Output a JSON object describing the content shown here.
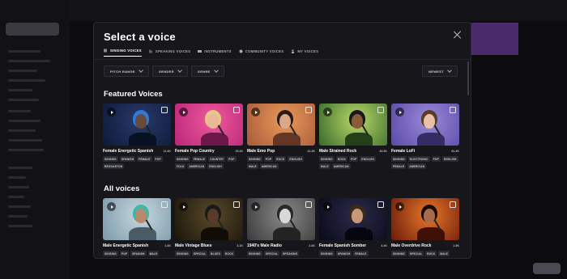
{
  "modal": {
    "title": "Select a voice",
    "tabs": [
      {
        "label": "SINGING VOICES",
        "icon": "bars-icon",
        "active": true
      },
      {
        "label": "SPEAKING VOICES",
        "icon": "speech-icon",
        "active": false
      },
      {
        "label": "INSTRUMENTS",
        "icon": "instrument-icon",
        "active": false
      },
      {
        "label": "COMMUNITY VOICES",
        "icon": "globe-icon",
        "active": false
      },
      {
        "label": "MY VOICES",
        "icon": "person-icon",
        "active": false
      }
    ],
    "filters": [
      {
        "label": "PITCH RANGE"
      },
      {
        "label": "GENDER"
      },
      {
        "label": "GENRE"
      }
    ],
    "sort": {
      "label": "NEWEST"
    }
  },
  "featured": {
    "title": "Featured Voices",
    "cards": [
      {
        "name": "Female Energetic Spanish",
        "count": "11.4K",
        "tags": [
          "SINGING",
          "SPANISH",
          "FEMALE",
          "POP",
          "REGGAETON"
        ],
        "bg": [
          "#2a3a6a",
          "#0d1a3a"
        ],
        "skin": "#6a4a3a",
        "hair": "#2c7bd8"
      },
      {
        "name": "Female Pop Country",
        "count": "19.2K",
        "tags": [
          "SINGING",
          "FEMALE",
          "COUNTRY",
          "POP",
          "FOLK",
          "AMERICAN",
          "ENGLISH"
        ],
        "bg": [
          "#f05a9a",
          "#b8267a"
        ],
        "skin": "#e8b898",
        "hair": "#e8c888"
      },
      {
        "name": "Male Emo Pop",
        "count": "41.2K",
        "tags": [
          "SINGING",
          "POP",
          "ROCK",
          "ENGLISH",
          "MALE",
          "AMERICAN"
        ],
        "bg": [
          "#e89a5a",
          "#a85a3a"
        ],
        "skin": "#d8a888",
        "hair": "#2a1a1a"
      },
      {
        "name": "Male Strained Rock",
        "count": "43.3K",
        "tags": [
          "SINGING",
          "ROCK",
          "POP",
          "ENGLISH",
          "MALE",
          "AMERICAN"
        ],
        "bg": [
          "#b8d86a",
          "#3a6a2a"
        ],
        "skin": "#8a5a3a",
        "hair": "#1a1a1a"
      },
      {
        "name": "Female LoFi",
        "count": "81.4K",
        "tags": [
          "SINGING",
          "ELECTRONIC",
          "POP",
          "ENGLISH",
          "FEMALE",
          "AMERICAN"
        ],
        "bg": [
          "#9a8ad8",
          "#5a4aa8"
        ],
        "skin": "#e8c0a8",
        "hair": "#5a3a2a"
      }
    ]
  },
  "all": {
    "title": "All voices",
    "cards": [
      {
        "name": "Male Energetic Spanish",
        "count": "1.6K",
        "tags": [
          "SINGING",
          "POP",
          "SPANISH",
          "MALE"
        ],
        "bg": [
          "#c8d8e0",
          "#7a98a8"
        ],
        "skin": "#b88a6a",
        "hair": "#3ab8a8"
      },
      {
        "name": "Male Vintage Blues",
        "count": "3.1K",
        "tags": [
          "SINGING",
          "SPECIAL",
          "BLUES",
          "ROCK"
        ],
        "bg": [
          "#5a4a2a",
          "#1a140a"
        ],
        "skin": "#5a3a2a",
        "hair": "#1a1a1a"
      },
      {
        "name": "1940's Male Radio",
        "count": "2.6K",
        "tags": [
          "SINGING",
          "SPECIAL",
          "SPEAKING"
        ],
        "bg": [
          "#8a8a8a",
          "#3a3a3a"
        ],
        "skin": "#d8d8d8",
        "hair": "#2a2a2a"
      },
      {
        "name": "Female Spanish Somber",
        "count": "4.4K",
        "tags": [
          "SINGING",
          "SPANISH",
          "FEMALE"
        ],
        "bg": [
          "#2a2a4a",
          "#0a0a1a"
        ],
        "skin": "#c89878",
        "hair": "#3a2a1a"
      },
      {
        "name": "Male Overdrive Rock",
        "count": "1.5K",
        "tags": [
          "SINGING",
          "SPECIAL",
          "ROCK",
          "MALE"
        ],
        "bg": [
          "#e8782a",
          "#6a1a0a"
        ],
        "skin": "#a86a4a",
        "hair": "#1a0a0a"
      }
    ]
  }
}
